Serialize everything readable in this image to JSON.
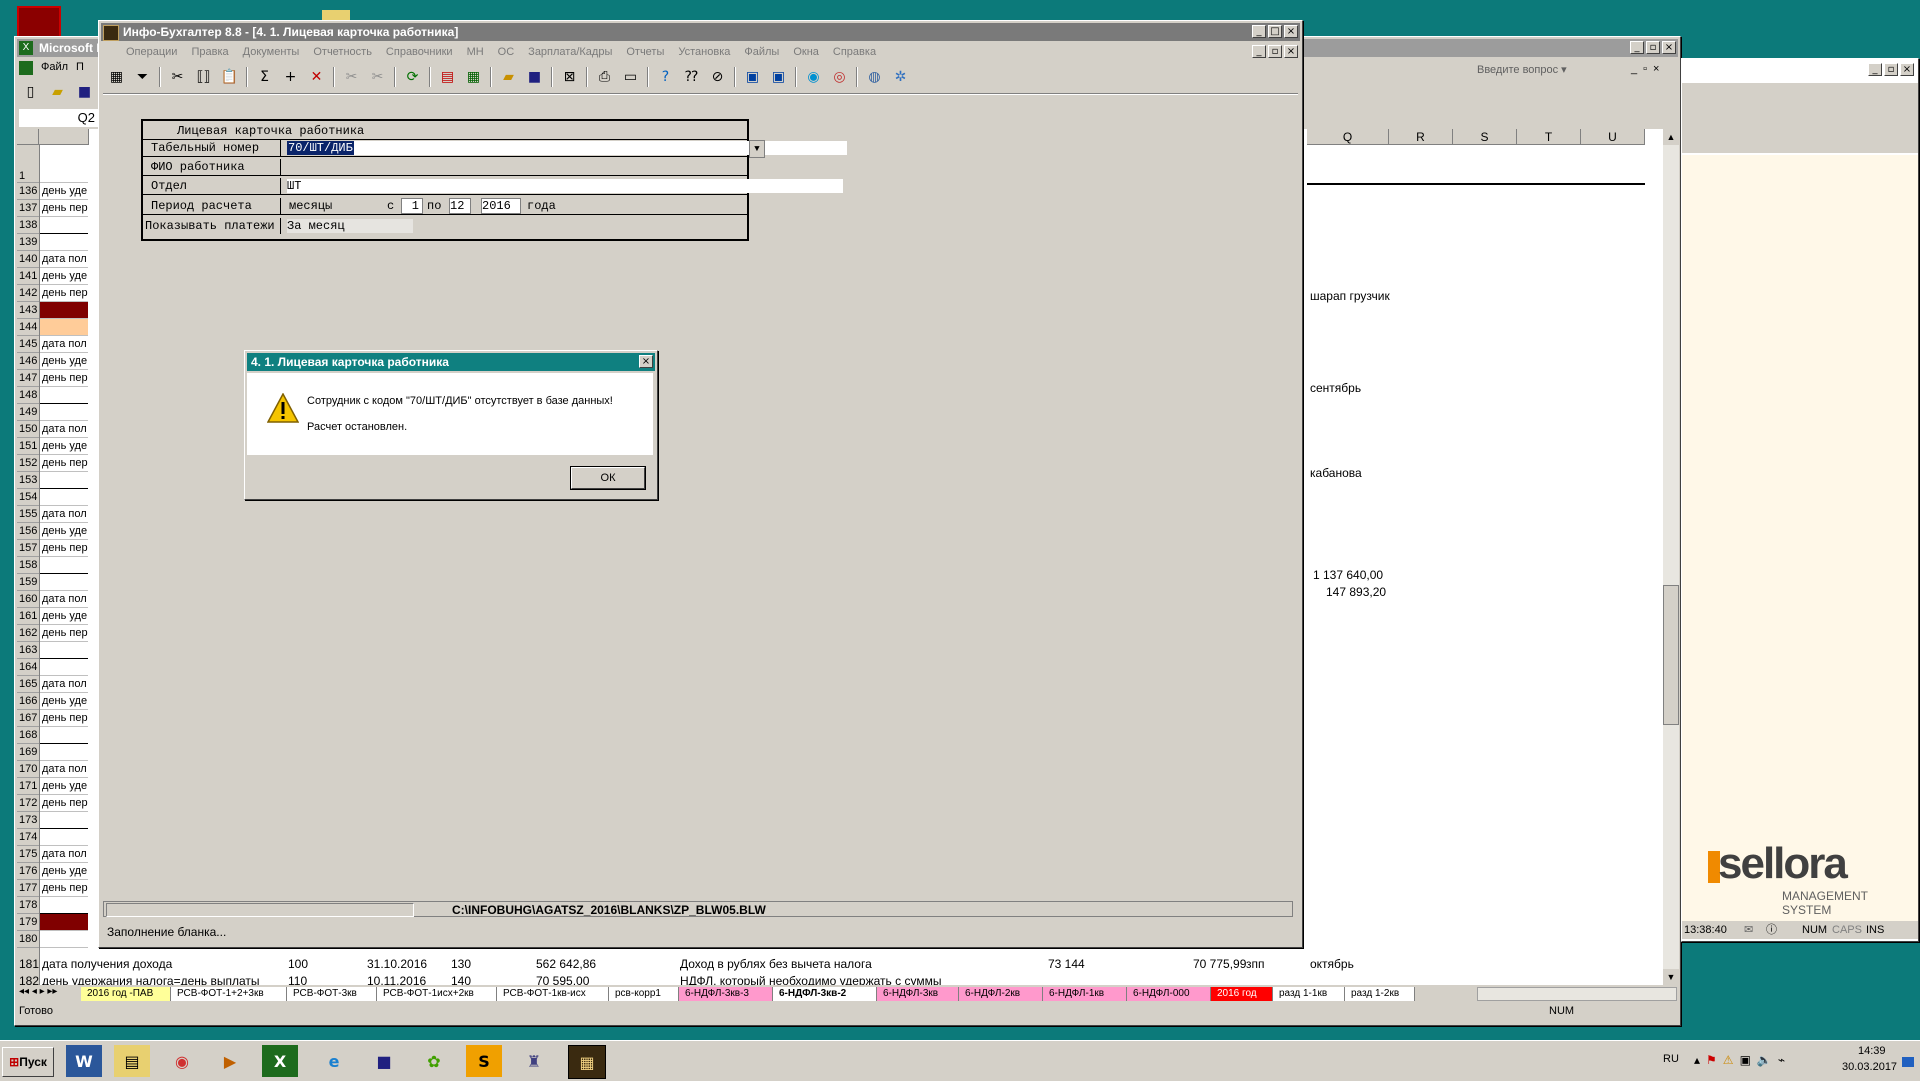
{
  "colors": {
    "desktop": "#0c7a7a",
    "dark_red": "#800000",
    "peach": "#ffcc99",
    "pink_tab": "#ff99cc",
    "red_tab": "#ff0000"
  },
  "excel": {
    "title": "Microsoft E",
    "menu": [
      "Файл",
      "П"
    ],
    "cell_ref": "Q2",
    "help_placeholder": "Введите вопрос",
    "col_headers": [
      "Q",
      "R",
      "S",
      "T",
      "U"
    ],
    "rows": [
      {
        "n": "1",
        "t": ""
      },
      {
        "n": "136",
        "t": "день уде"
      },
      {
        "n": "137",
        "t": "день пер"
      },
      {
        "n": "138",
        "t": ""
      },
      {
        "n": "139",
        "t": ""
      },
      {
        "n": "140",
        "t": "дата пол"
      },
      {
        "n": "141",
        "t": "день уде"
      },
      {
        "n": "142",
        "t": "день пер"
      },
      {
        "n": "143",
        "t": ""
      },
      {
        "n": "144",
        "t": ""
      },
      {
        "n": "145",
        "t": "дата пол"
      },
      {
        "n": "146",
        "t": "день уде"
      },
      {
        "n": "147",
        "t": "день пер"
      },
      {
        "n": "148",
        "t": ""
      },
      {
        "n": "149",
        "t": ""
      },
      {
        "n": "150",
        "t": "дата пол"
      },
      {
        "n": "151",
        "t": "день уде"
      },
      {
        "n": "152",
        "t": "день пер"
      },
      {
        "n": "153",
        "t": ""
      },
      {
        "n": "154",
        "t": ""
      },
      {
        "n": "155",
        "t": "дата пол"
      },
      {
        "n": "156",
        "t": "день уде"
      },
      {
        "n": "157",
        "t": "день пер"
      },
      {
        "n": "158",
        "t": ""
      },
      {
        "n": "159",
        "t": ""
      },
      {
        "n": "160",
        "t": "дата пол"
      },
      {
        "n": "161",
        "t": "день уде"
      },
      {
        "n": "162",
        "t": "день пер"
      },
      {
        "n": "163",
        "t": ""
      },
      {
        "n": "164",
        "t": ""
      },
      {
        "n": "165",
        "t": "дата пол"
      },
      {
        "n": "166",
        "t": "день уде"
      },
      {
        "n": "167",
        "t": "день пер"
      },
      {
        "n": "168",
        "t": ""
      },
      {
        "n": "169",
        "t": ""
      },
      {
        "n": "170",
        "t": "дата пол"
      },
      {
        "n": "171",
        "t": "день уде"
      },
      {
        "n": "172",
        "t": "день пер"
      },
      {
        "n": "173",
        "t": ""
      },
      {
        "n": "174",
        "t": ""
      },
      {
        "n": "175",
        "t": "дата пол"
      },
      {
        "n": "176",
        "t": "день уде"
      },
      {
        "n": "177",
        "t": "день пер"
      },
      {
        "n": "178",
        "t": ""
      },
      {
        "n": "179",
        "t": ""
      },
      {
        "n": "180",
        "t": ""
      }
    ],
    "q_cells": {
      "r140": "шарап грузчик",
      "r145": "сентябрь",
      "r150": "кабанова",
      "r156": "1 137 640,00",
      "r157": "147 893,20"
    },
    "row181": {
      "n": "181",
      "a": "дата получения дохода",
      "b": "100",
      "c": "31.10.2016",
      "d": "130",
      "e": "562 642,86",
      "f": "Доход в рублях без вычета налога",
      "g": "73 144",
      "h": "70 775,99",
      "i": "зпп",
      "q": "октябрь"
    },
    "row182": {
      "n": "182",
      "a": "день удержания налога=день выплаты",
      "b": "110",
      "c": "10.11.2016",
      "d": "140",
      "e": "70 595,00",
      "f": "НДФЛ, который необходимо удержать с суммы"
    },
    "sheet_tabs": [
      "2016 год -ПАВ",
      "РСВ-ФОТ-1+2+3кв",
      "РСВ-ФОТ-3кв",
      "РСВ-ФОТ-1исх+2кв",
      "РСВ-ФОТ-1кв-исх",
      "рсв-корр1",
      "6-НДФЛ-3кв-3",
      "6-НДФЛ-3кв-2",
      "6-НДФЛ-3кв",
      "6-НДФЛ-2кв",
      "6-НДФЛ-1кв",
      "6-НДФЛ-000",
      "2016 год",
      "разд 1-1кв",
      "разд 1-2кв"
    ],
    "status": "Готово",
    "status_num": "NUM"
  },
  "infobuh": {
    "title": "Инфо-Бухгалтер 8.8 - [4. 1. Лицевая карточка работника]",
    "menu": [
      "Операции",
      "Правка",
      "Документы",
      "Отчетность",
      "Справочники",
      "МН",
      "ОС",
      "Зарплата/Кадры",
      "Отчеты",
      "Установка",
      "Файлы",
      "Окна",
      "Справка"
    ],
    "toolbar_icons": [
      "grid-icon",
      "filter-icon",
      "scissors-icon",
      "brackets-icon",
      "clipboard-icon",
      "sum-icon",
      "plus-icon",
      "delete-icon",
      "cut-icon",
      "cut2-icon",
      "refresh-icon",
      "pdf-icon",
      "calc-icon",
      "open-folder-icon",
      "save-icon",
      "export-icon",
      "print-icon",
      "page-icon",
      "help-icon",
      "whats-this-icon",
      "compass-icon",
      "book-icon",
      "ne-icon",
      "skype-icon",
      "lifebuoy-icon",
      "globe-icon",
      "settings-icon"
    ],
    "form": {
      "header": "Лицевая карточка работника",
      "tab_label": "Табельный номер",
      "tab_value": "70/ШТ/ДИБ",
      "fio_label": "ФИО работника",
      "fio_value": "",
      "dept_label": "Отдел",
      "dept_value": "ШТ",
      "period_label": "Период расчета",
      "period_months": "месяцы",
      "period_from_word": "с",
      "period_from": "1",
      "period_to_word": "по",
      "period_to": "12",
      "period_year": "2016",
      "period_year_word": "года",
      "payments_label": "Показывать платежи",
      "payments_value": "За месяц"
    },
    "path": "C:\\INFOBUHG\\AGATSZ_2016\\BLANKS\\ZP_BLW05.BLW",
    "status": "Заполнение бланка..."
  },
  "dialog": {
    "title": "4. 1. Лицевая карточка работника",
    "message": "Сотрудник с кодом \"70/ШТ/ДИБ\" отсутствует в базе данных!",
    "message2": "Расчет остановлен.",
    "ok": "ОК"
  },
  "right_window": {
    "logo": "sellora",
    "logo_sub1": "MANAGEMENT",
    "logo_sub2": "SYSTEM",
    "time": "13:38:40",
    "num": "NUM",
    "caps": "CAPS",
    "ins": "INS"
  },
  "taskbar": {
    "start": "Пуск",
    "lang": "RU",
    "time": "14:39",
    "date": "30.03.2017"
  }
}
